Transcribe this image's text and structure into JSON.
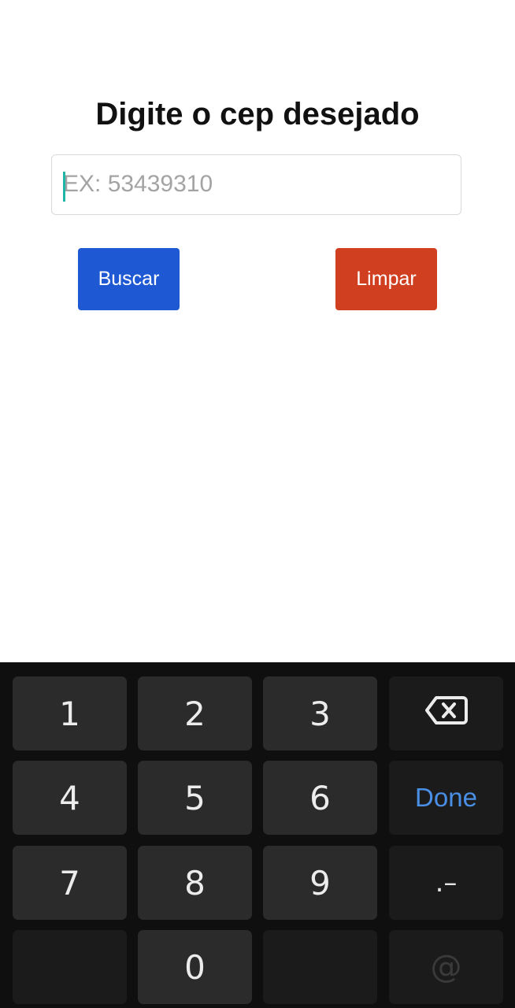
{
  "page": {
    "title": "Digite o cep desejado"
  },
  "cep_input": {
    "placeholder": "EX: 53439310",
    "value": ""
  },
  "buttons": {
    "search_label": "Buscar",
    "clear_label": "Limpar"
  },
  "colors": {
    "search_button": "#1e59d3",
    "clear_button": "#d03f1f",
    "caret": "#1fb6a8",
    "done_text": "#4a8fe6",
    "keyboard_bg": "#0f0f0f"
  },
  "keyboard": {
    "keys": {
      "k1": "1",
      "k2": "2",
      "k3": "3",
      "k4": "4",
      "k5": "5",
      "k6": "6",
      "k7": "7",
      "k8": "8",
      "k9": "9",
      "k0": "0",
      "done": "Done",
      "punct": ".–",
      "at": "@"
    },
    "backspace_icon": "backspace-icon"
  }
}
